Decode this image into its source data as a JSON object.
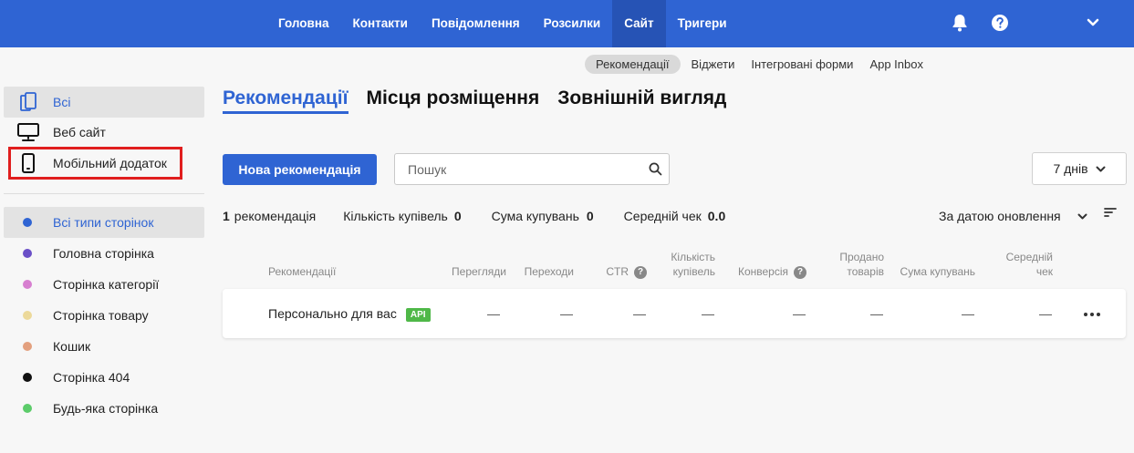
{
  "topnav": {
    "items": [
      {
        "label": "Головна"
      },
      {
        "label": "Контакти"
      },
      {
        "label": "Повідомлення"
      },
      {
        "label": "Розсилки"
      },
      {
        "label": "Сайт"
      },
      {
        "label": "Тригери"
      }
    ],
    "active_index": 4,
    "icons": [
      "bell-icon",
      "help-icon",
      "chevron-down-icon"
    ]
  },
  "subnav": {
    "items": [
      {
        "label": "Рекомендації"
      },
      {
        "label": "Віджети"
      },
      {
        "label": "Інтегровані форми"
      },
      {
        "label": "App Inbox"
      }
    ],
    "active_index": 0
  },
  "sidebar": {
    "platforms": [
      {
        "label": "Всі",
        "icon": "all-devices-icon"
      },
      {
        "label": "Веб сайт",
        "icon": "monitor-icon"
      },
      {
        "label": "Мобільний додаток",
        "icon": "mobile-icon"
      }
    ],
    "page_types": [
      {
        "label": "Всі типи сторінок",
        "color": "#2f64d3"
      },
      {
        "label": "Головна сторінка",
        "color": "#6a4fc7"
      },
      {
        "label": "Сторінка категорії",
        "color": "#d77fd0"
      },
      {
        "label": "Сторінка товару",
        "color": "#ecd99a"
      },
      {
        "label": "Кошик",
        "color": "#e3a07e"
      },
      {
        "label": "Сторінка 404",
        "color": "#111111"
      },
      {
        "label": "Будь-яка сторінка",
        "color": "#5ccc6a"
      }
    ]
  },
  "tabs": [
    {
      "label": "Рекомендації"
    },
    {
      "label": "Місця розміщення"
    },
    {
      "label": "Зовнішній вигляд"
    }
  ],
  "controls": {
    "new_button": "Нова рекомендація",
    "search_placeholder": "Пошук",
    "period": "7 днів"
  },
  "summary": {
    "count": "1",
    "count_label": "рекомендація",
    "purchases_label": "Кількість купівель",
    "purchases_value": "0",
    "sum_label": "Сума купувань",
    "sum_value": "0",
    "avg_label": "Середній чек",
    "avg_value": "0.0",
    "sort_label": "За датою оновлення"
  },
  "table": {
    "headers": {
      "name": "Рекомендації",
      "views": "Перегляди",
      "clicks": "Переходи",
      "ctr": "CTR",
      "purchases_1": "Кількість",
      "purchases_2": "купівель",
      "conversion": "Конверсія",
      "sold_1": "Продано",
      "sold_2": "товарів",
      "sum": "Сума купувань",
      "avg_1": "Середній",
      "avg_2": "чек"
    },
    "rows": [
      {
        "name": "Персонально для вас",
        "badge": "API",
        "views": "—",
        "clicks": "—",
        "ctr": "—",
        "purchases": "—",
        "conversion": "—",
        "sold": "—",
        "sum": "—",
        "avg": "—"
      }
    ]
  },
  "colors": {
    "brand": "#2f64d3",
    "highlight": "#e01e1e",
    "api_badge": "#4fb848"
  }
}
